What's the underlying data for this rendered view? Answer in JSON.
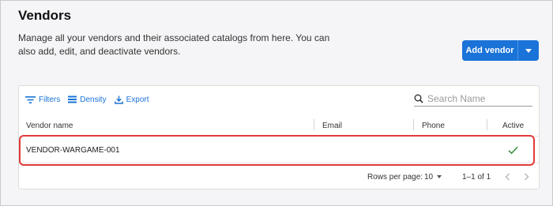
{
  "header": {
    "title": "Vendors",
    "description": "Manage all your vendors and their associated catalogs from here. You can also add, edit, and deactivate vendors.",
    "add_button_label": "Add vendor"
  },
  "toolbar": {
    "filters_label": "Filters",
    "density_label": "Density",
    "export_label": "Export",
    "search_placeholder": "Search Name"
  },
  "table": {
    "columns": [
      "Vendor name",
      "Email",
      "Phone",
      "Active"
    ],
    "rows": [
      {
        "vendor_name": "VENDOR-WARGAME-001",
        "email": "",
        "phone": "",
        "active": "✓"
      }
    ]
  },
  "pagination": {
    "rows_per_page_label": "Rows per page:",
    "rows_per_page_value": "10",
    "range_text": "1–1 of 1"
  },
  "colors": {
    "accent": "#1a73d8",
    "highlight": "#e23b3b",
    "check": "#2e8b3a"
  }
}
